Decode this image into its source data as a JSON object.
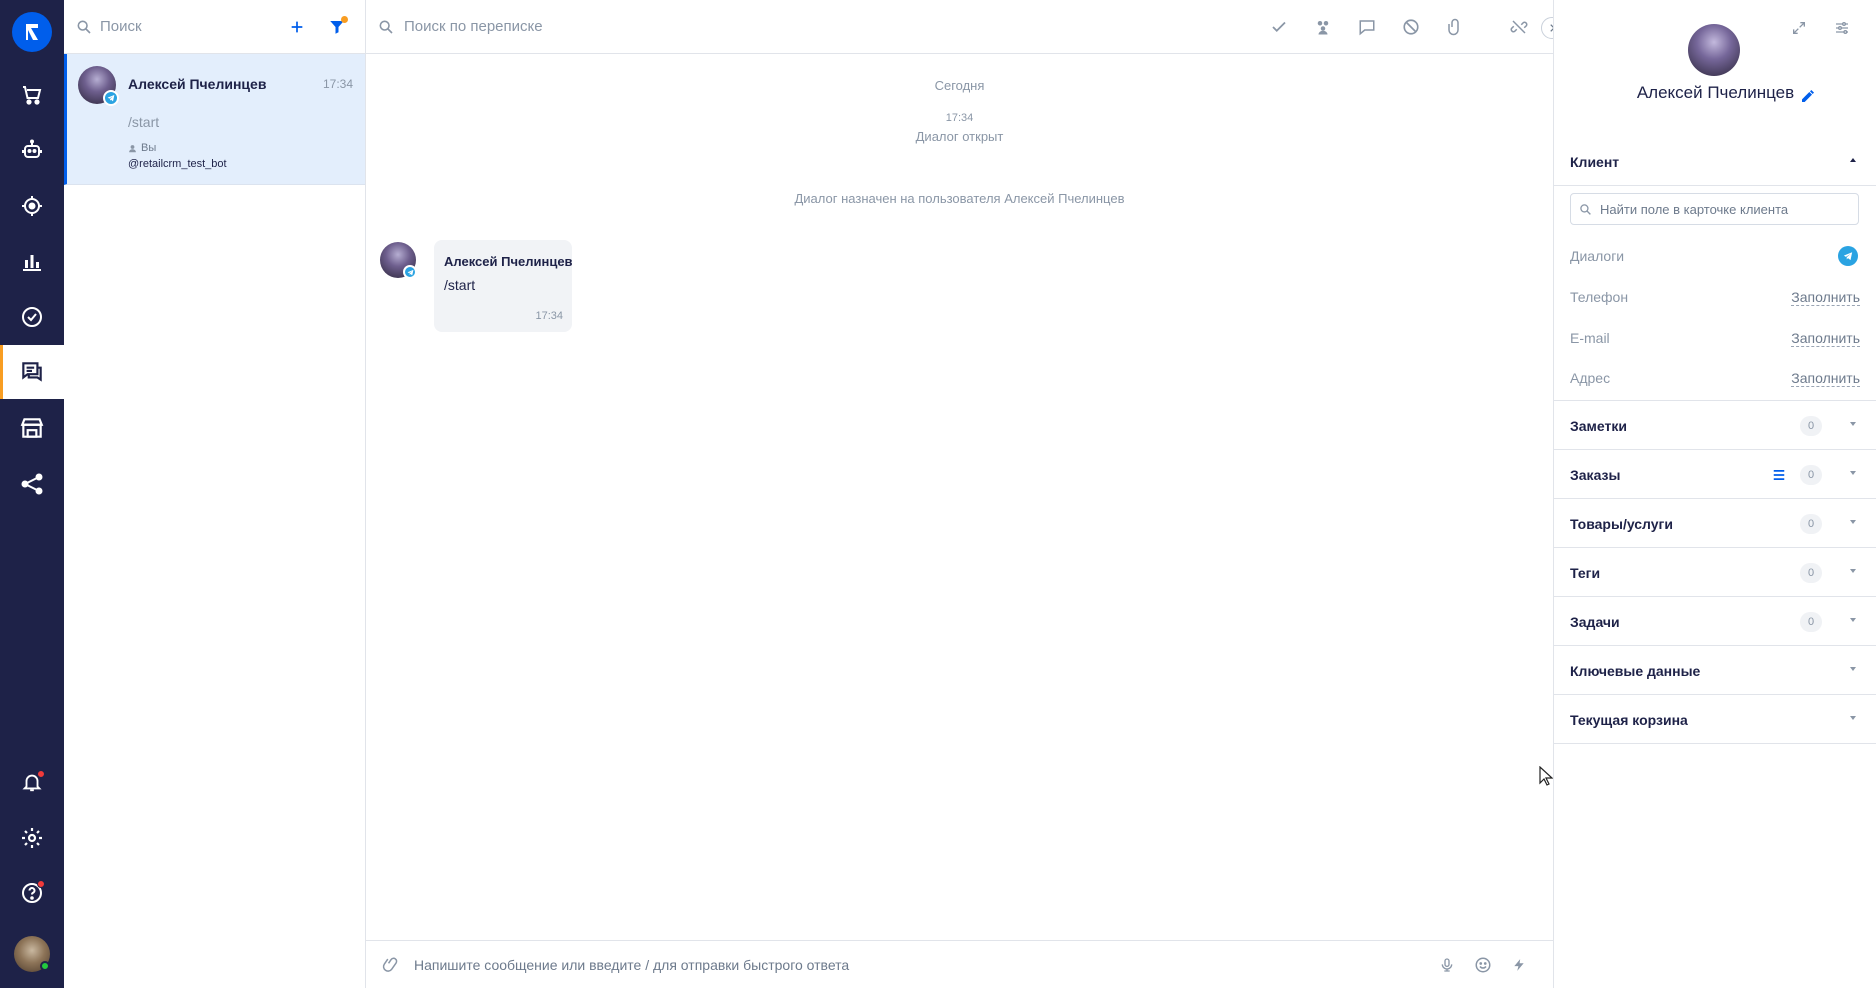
{
  "app": {
    "brand_color": "#005eeb",
    "rail_color": "#1e2248",
    "accent": "#f89d22"
  },
  "rail": {
    "items": [
      {
        "icon": "cart-icon"
      },
      {
        "icon": "bot-icon"
      },
      {
        "icon": "target-icon"
      },
      {
        "icon": "analytics-icon"
      },
      {
        "icon": "tasks-icon"
      },
      {
        "icon": "chats-icon",
        "active": true
      },
      {
        "icon": "store-icon"
      },
      {
        "icon": "integrations-icon"
      }
    ],
    "bottom": [
      {
        "icon": "bell-icon",
        "badge": true
      },
      {
        "icon": "settings-icon"
      },
      {
        "icon": "help-icon",
        "badge": true
      }
    ]
  },
  "dialogs": {
    "search_placeholder": "Поиск",
    "items": [
      {
        "name": "Алексей Пчелинцев",
        "time": "17:34",
        "preview": "/start",
        "assignee": "Вы",
        "channel": "@retailcrm_test_bot"
      }
    ]
  },
  "chat": {
    "search_placeholder": "Поиск по переписке",
    "date_divider": "Сегодня",
    "event_time": "17:34",
    "event_text": "Диалог открыт",
    "assigned_text": "Диалог назначен на пользователя Алексей Пчелинцев",
    "messages": [
      {
        "author": "Алексей Пчелинцев",
        "text": "/start",
        "time": "17:34"
      }
    ],
    "composer_placeholder": "Напишите сообщение или введите / для отправки быстрого ответа"
  },
  "panel": {
    "client_name": "Алексей Пчелинцев",
    "client_section": "Клиент",
    "field_search_placeholder": "Найти поле в карточке клиента",
    "fields": {
      "dialogs_label": "Диалоги",
      "phone_label": "Телефон",
      "email_label": "E-mail",
      "address_label": "Адрес",
      "fill_action": "Заполнить"
    },
    "sections": [
      {
        "title": "Заметки",
        "count": "0"
      },
      {
        "title": "Заказы",
        "count": "0"
      },
      {
        "title": "Товары/услуги",
        "count": "0"
      },
      {
        "title": "Теги",
        "count": "0"
      },
      {
        "title": "Задачи",
        "count": "0"
      },
      {
        "title": "Ключевые данные"
      },
      {
        "title": "Текущая корзина"
      }
    ]
  }
}
